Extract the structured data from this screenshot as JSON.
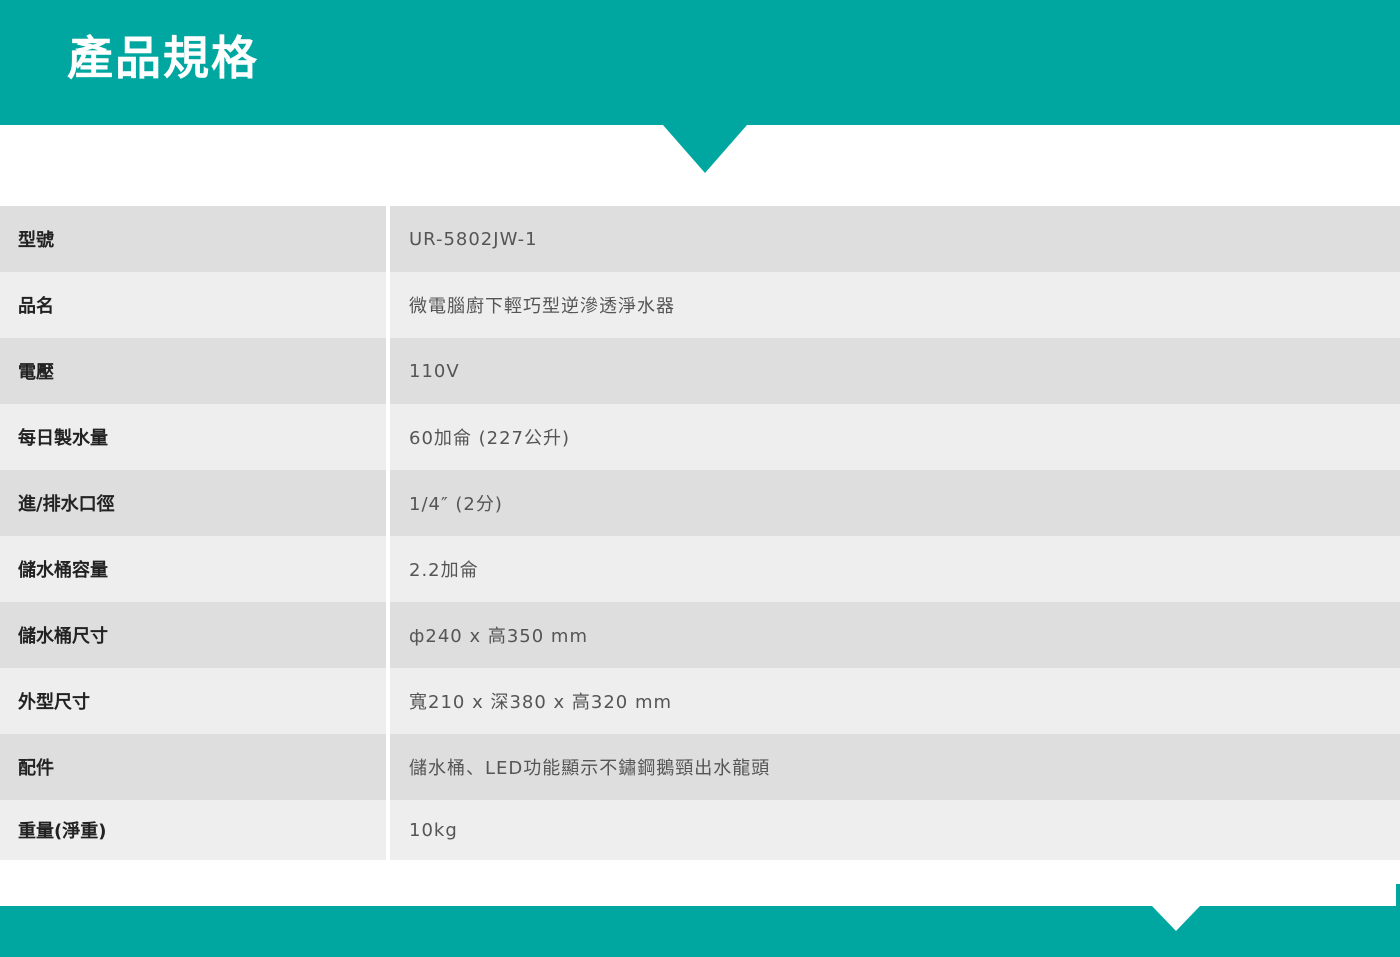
{
  "header": {
    "title": "產品規格"
  },
  "colors": {
    "brand_teal": "#00a7a0",
    "row_dark": "#dedede",
    "row_light": "#eeeeee"
  },
  "specs": [
    {
      "label": "型號",
      "value": "UR-5802JW-1"
    },
    {
      "label": "品名",
      "value": "微電腦廚下輕巧型逆滲透淨水器"
    },
    {
      "label": "電壓",
      "value": "110V"
    },
    {
      "label": "每日製水量",
      "value": "60加侖 (227公升)"
    },
    {
      "label": "進/排水口徑",
      "value": "1/4″ (2分)"
    },
    {
      "label": "儲水桶容量",
      "value": "2.2加侖"
    },
    {
      "label": "儲水桶尺寸",
      "value": "ф240 x 高350 mm"
    },
    {
      "label": "外型尺寸",
      "value": "寬210 x 深380 x 高320 mm"
    },
    {
      "label": "配件",
      "value": "儲水桶、LED功能顯示不鏽鋼鵝頸出水龍頭"
    },
    {
      "label": "重量(淨重)",
      "value": "10kg"
    }
  ]
}
